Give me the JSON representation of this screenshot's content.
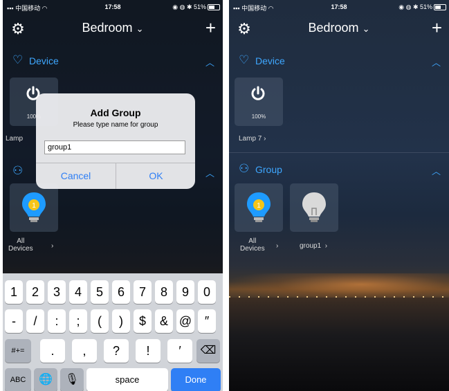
{
  "status": {
    "carrier": "中国移动",
    "time": "17:58",
    "battery": "51%"
  },
  "nav": {
    "title": "Bedroom"
  },
  "device_section": {
    "label": "Device"
  },
  "group_section": {
    "label": "Group"
  },
  "device_tile": {
    "percent": "100%",
    "label_left": "Lamp",
    "label_right": "Lamp 7"
  },
  "group_tiles": {
    "all_count": "1",
    "all_label_line1": "All",
    "all_label_line2": "Devices",
    "group1_label": "group1"
  },
  "dialog": {
    "title": "Add Group",
    "message": "Please type name for group",
    "input_value": "group1",
    "cancel": "Cancel",
    "ok": "OK"
  },
  "keyboard": {
    "row1": [
      "1",
      "2",
      "3",
      "4",
      "5",
      "6",
      "7",
      "8",
      "9",
      "0"
    ],
    "row2": [
      "-",
      "/",
      ":",
      ";",
      "(",
      ")",
      "$",
      "&",
      "@",
      "″"
    ],
    "row3_mid": [
      ".",
      ",",
      "?",
      "!",
      "′"
    ],
    "shift_label": "#+=",
    "abc_label": "ABC",
    "space_label": "space",
    "done_label": "Done"
  },
  "colors": {
    "accent": "#3ea7ff",
    "ios_blue": "#2f7ff5"
  }
}
